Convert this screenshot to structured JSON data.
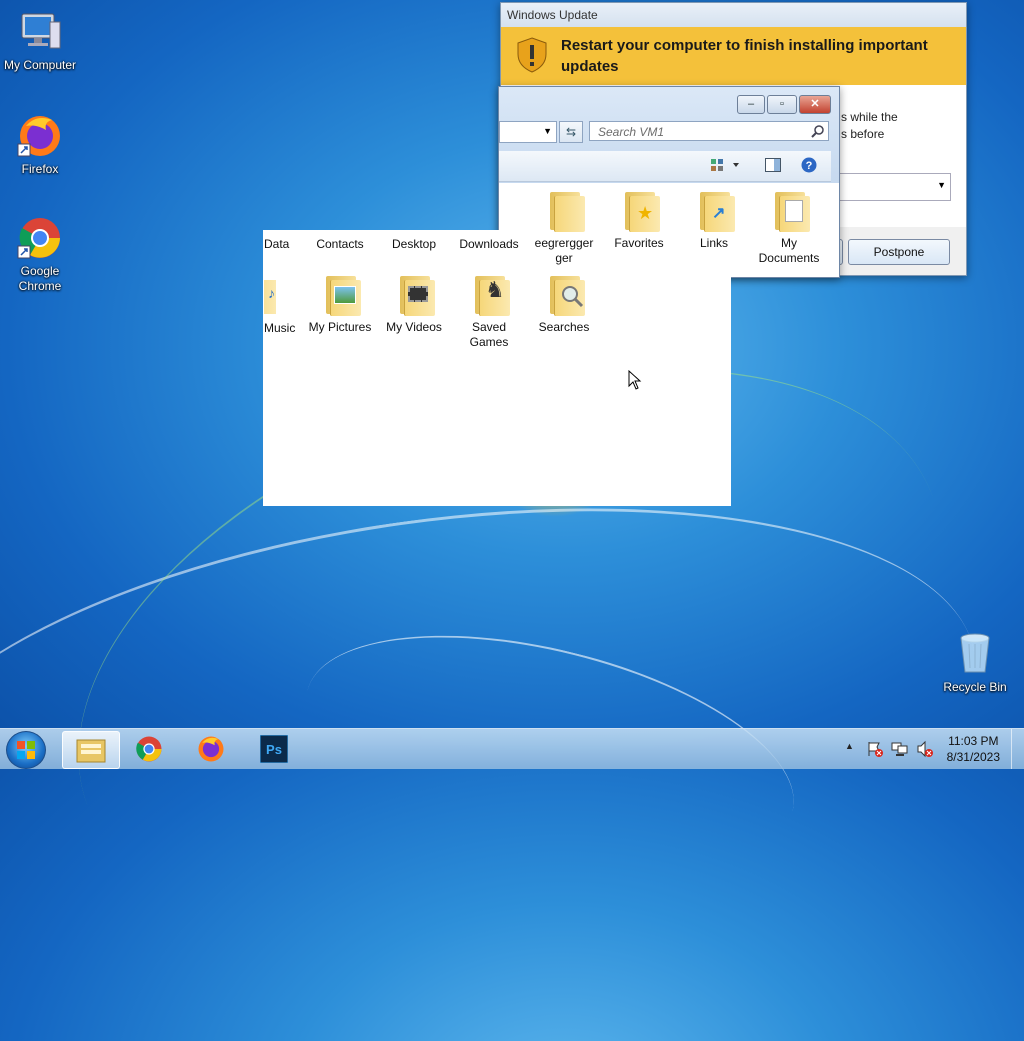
{
  "desktop": {
    "icons": [
      {
        "label": "My Computer"
      },
      {
        "label": "Firefox"
      },
      {
        "label": "Google Chrome"
      },
      {
        "label": "Recycle Bin"
      }
    ]
  },
  "windows_update": {
    "title": "Windows Update",
    "banner": "Restart your computer to finish installing important updates",
    "body_partial": "s while the\ns before",
    "postpone_label": "Postpone"
  },
  "explorer": {
    "search_placeholder": "Search VM1",
    "folders": [
      {
        "label": "Data"
      },
      {
        "label": "Contacts"
      },
      {
        "label": "Desktop"
      },
      {
        "label": "Downloads"
      },
      {
        "label": "eegrergger ger"
      },
      {
        "label": "Favorites"
      },
      {
        "label": "Links"
      },
      {
        "label": "My Documents"
      },
      {
        "label": "Music"
      },
      {
        "label": "My Pictures"
      },
      {
        "label": "My Videos"
      },
      {
        "label": "Saved Games"
      },
      {
        "label": "Searches"
      }
    ]
  },
  "taskbar": {
    "time": "11:03 PM",
    "date": "8/31/2023",
    "buttons": [
      "explorer",
      "chrome",
      "firefox",
      "photoshop"
    ]
  },
  "colors": {
    "banner": "#f4c13a",
    "desktop": "#1466c2"
  }
}
